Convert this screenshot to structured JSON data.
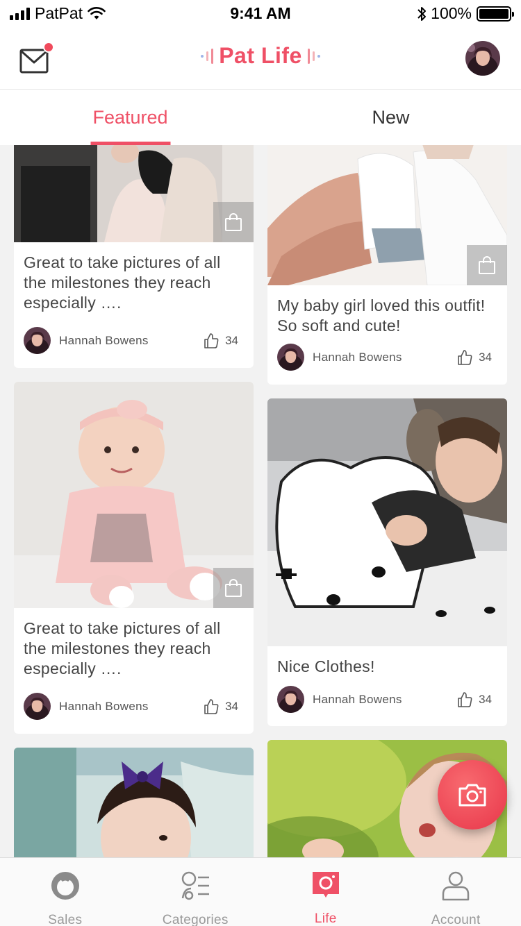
{
  "status_bar": {
    "carrier": "PatPat",
    "time": "9:41 AM",
    "battery": "100%"
  },
  "header": {
    "logo_text": "Pat Life"
  },
  "tabs": [
    {
      "label": "Featured",
      "active": true
    },
    {
      "label": "New",
      "active": false
    }
  ],
  "posts": [
    {
      "caption": "Great to take pictures of all the milestones they reach especially ….",
      "author": "Hannah Bowens",
      "likes": "34"
    },
    {
      "caption": "My baby girl loved this outfit! So soft and cute!",
      "author": "Hannah Bowens",
      "likes": "34"
    },
    {
      "caption": "Great to take pictures of all the milestones they reach especially ….",
      "author": "Hannah Bowens",
      "likes": "34"
    },
    {
      "caption": "Nice Clothes!",
      "author": "Hannah Bowens",
      "likes": "34"
    }
  ],
  "bottom_nav": [
    {
      "label": "Sales",
      "icon": "sales-icon",
      "active": false
    },
    {
      "label": "Categories",
      "icon": "categories-icon",
      "active": false
    },
    {
      "label": "Life",
      "icon": "life-camera-icon",
      "active": true
    },
    {
      "label": "Account",
      "icon": "account-icon",
      "active": false
    }
  ],
  "colors": {
    "accent": "#ef5066",
    "background": "#f2f2f2",
    "inactive": "#999999"
  },
  "icons": [
    "mail-icon",
    "shopping-bag-icon",
    "thumbs-up-icon",
    "camera-icon"
  ]
}
